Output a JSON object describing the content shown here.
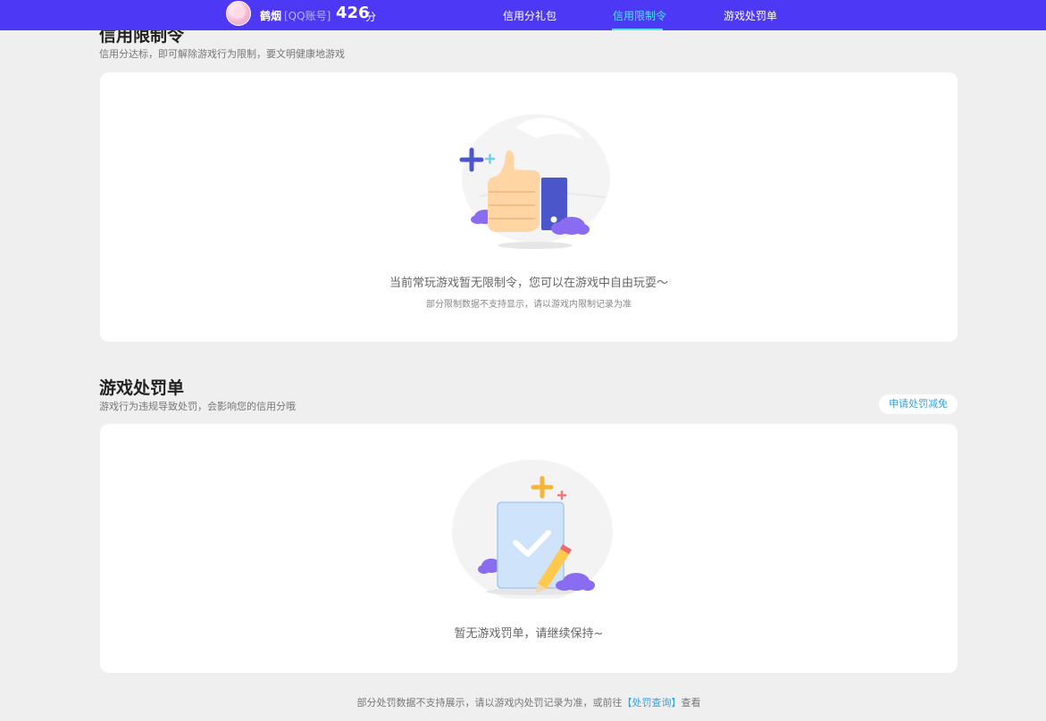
{
  "header": {
    "username": "鹤烟",
    "account_type": "[QQ账号]",
    "score": "426",
    "score_unit": "分",
    "tabs": [
      {
        "label": "信用分礼包",
        "active": false
      },
      {
        "label": "信用限制令",
        "active": true
      },
      {
        "label": "游戏处罚单",
        "active": false
      }
    ],
    "accent_color": "#4d38f5",
    "active_tab_color": "#4ee2ff"
  },
  "restriction": {
    "title": "信用限制令",
    "subtitle": "信用分达标，即可解除游戏行为限制，要文明健康地游戏",
    "empty_message": "当前常玩游戏暂无限制令，您可以在游戏中自由玩耍～",
    "empty_note": "部分限制数据不支持显示，请以游戏内限制记录为准",
    "illustration_icon": "thumbs-up-icon"
  },
  "penalty": {
    "title": "游戏处罚单",
    "subtitle": "游戏行为违规导致处罚，会影响您的信用分哦",
    "appeal_label": "申请处罚减免",
    "empty_message": "暂无游戏罚单，请继续保持~",
    "illustration_icon": "clipboard-check-icon"
  },
  "footer": {
    "text_before": "部分处罚数据不支持展示，请以游戏内处罚记录为准，或前往",
    "link_label": "【处罚查询】",
    "text_after": "查看"
  }
}
